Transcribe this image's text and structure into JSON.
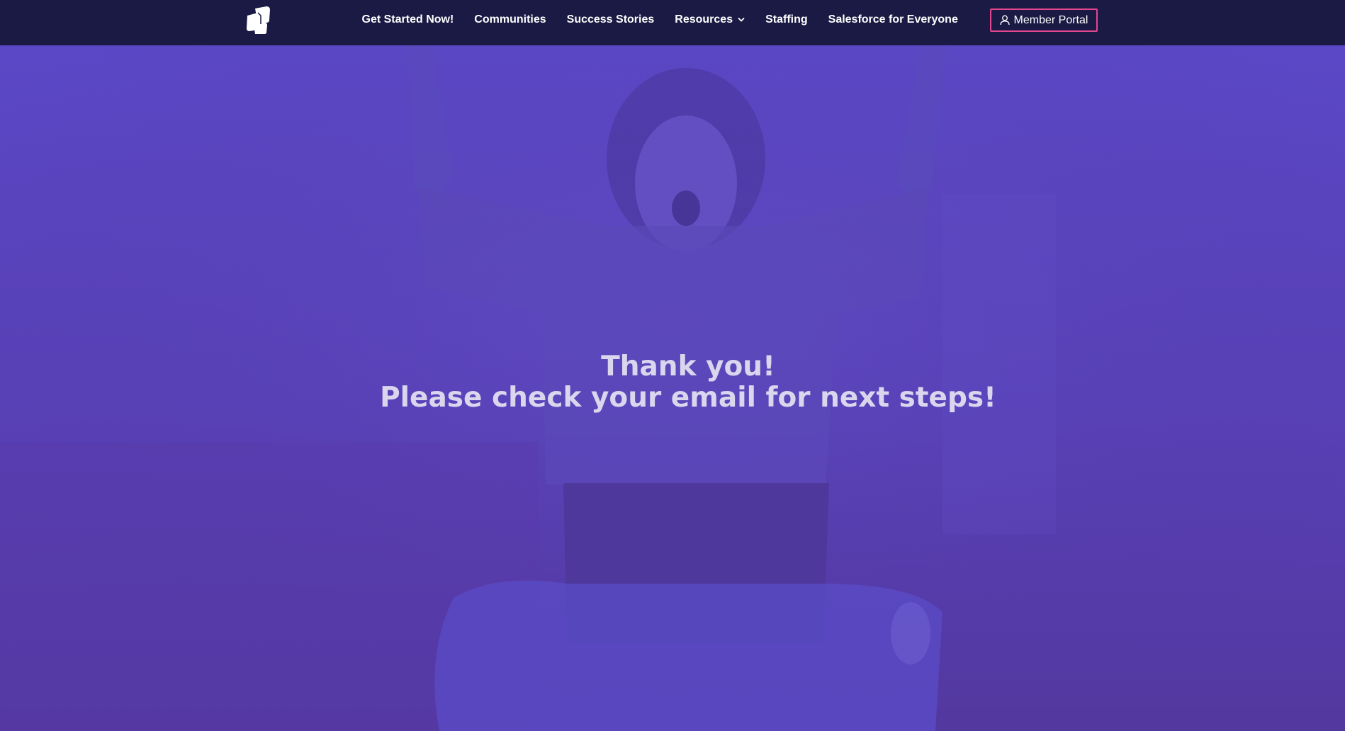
{
  "nav": {
    "logo_icon": "site-logo-icon",
    "links": [
      {
        "label": "Get Started Now!"
      },
      {
        "label": "Communities"
      },
      {
        "label": "Success Stories"
      },
      {
        "label": "Resources"
      },
      {
        "label": "Staffing"
      },
      {
        "label": "Salesforce for Everyone"
      }
    ],
    "resources_dropdown_icon": "chevron-down-icon",
    "member_portal": {
      "label": "Member Portal",
      "icon": "user-icon"
    }
  },
  "hero": {
    "line1": "Thank you!",
    "line2": "Please check your email for next steps!"
  },
  "colors": {
    "navbar_bg": "#1b1a44",
    "hero_overlay": "#5a46bf",
    "member_border": "#e2478f",
    "hero_text": "#d9d6ee"
  }
}
